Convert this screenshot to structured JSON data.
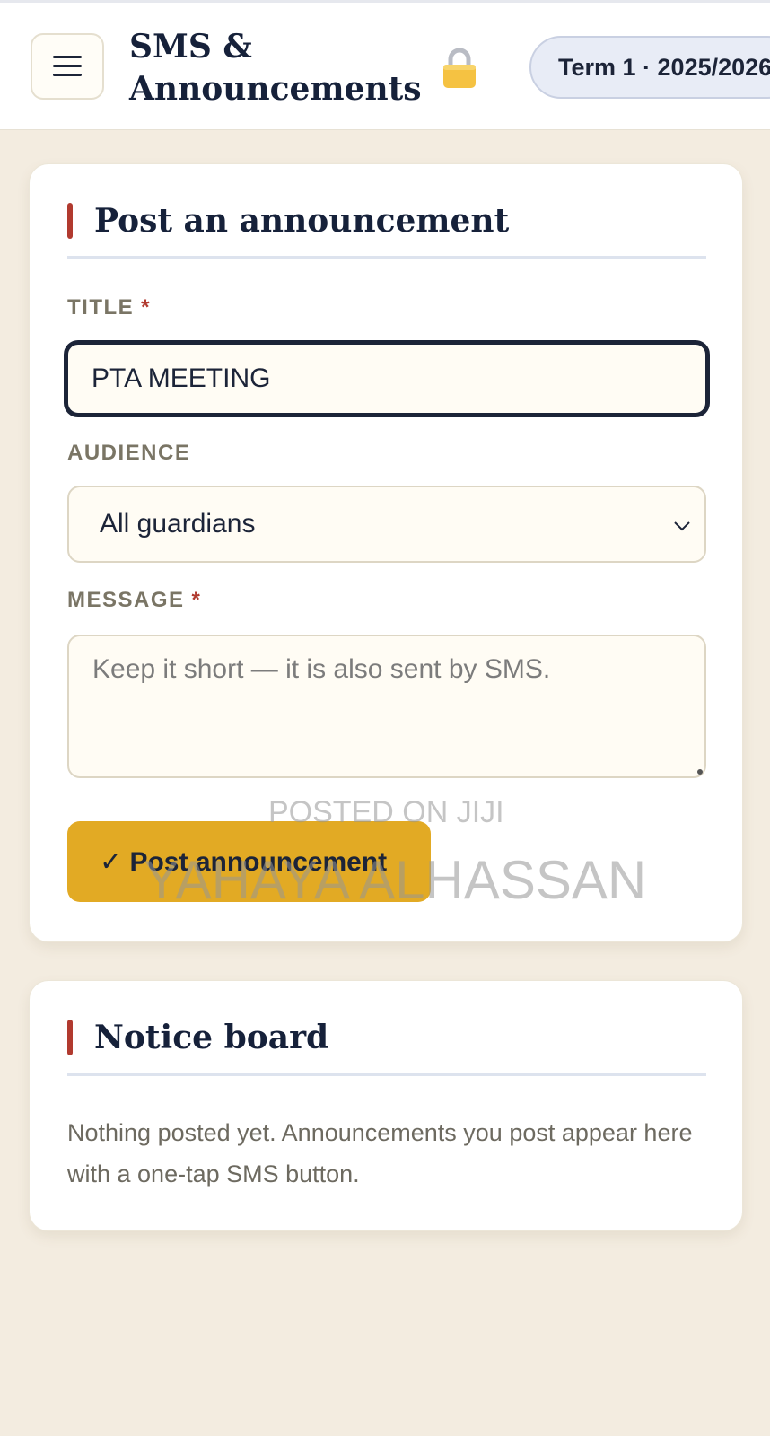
{
  "header": {
    "title": "SMS & Announcements",
    "lock_icon": "lock-icon",
    "term_label": "Term 1 · 2025/2026",
    "menu_icon": "hamburger-menu-icon"
  },
  "post_card": {
    "heading": "Post an announcement",
    "title_field": {
      "label": "TITLE",
      "required_mark": "*",
      "value": "PTA MEETING"
    },
    "audience_field": {
      "label": "AUDIENCE",
      "selected": "All guardians"
    },
    "message_field": {
      "label": "MESSAGE",
      "required_mark": "*",
      "placeholder": "Keep it short — it is also sent by SMS.",
      "value": ""
    },
    "submit_label": "✓ Post announcement"
  },
  "notice_card": {
    "heading": "Notice board",
    "empty_text": "Nothing posted yet. Announcements you post appear here with a one-tap SMS button."
  },
  "watermark": {
    "line1": "POSTED ON JIJI",
    "line2": "YAHAYA ALHASSAN"
  },
  "colors": {
    "page_bg": "#f3ece0",
    "accent_red": "#b13a2f",
    "primary_button": "#e2aa24",
    "navy": "#16213a",
    "term_pill_bg": "#e8ecf6"
  }
}
